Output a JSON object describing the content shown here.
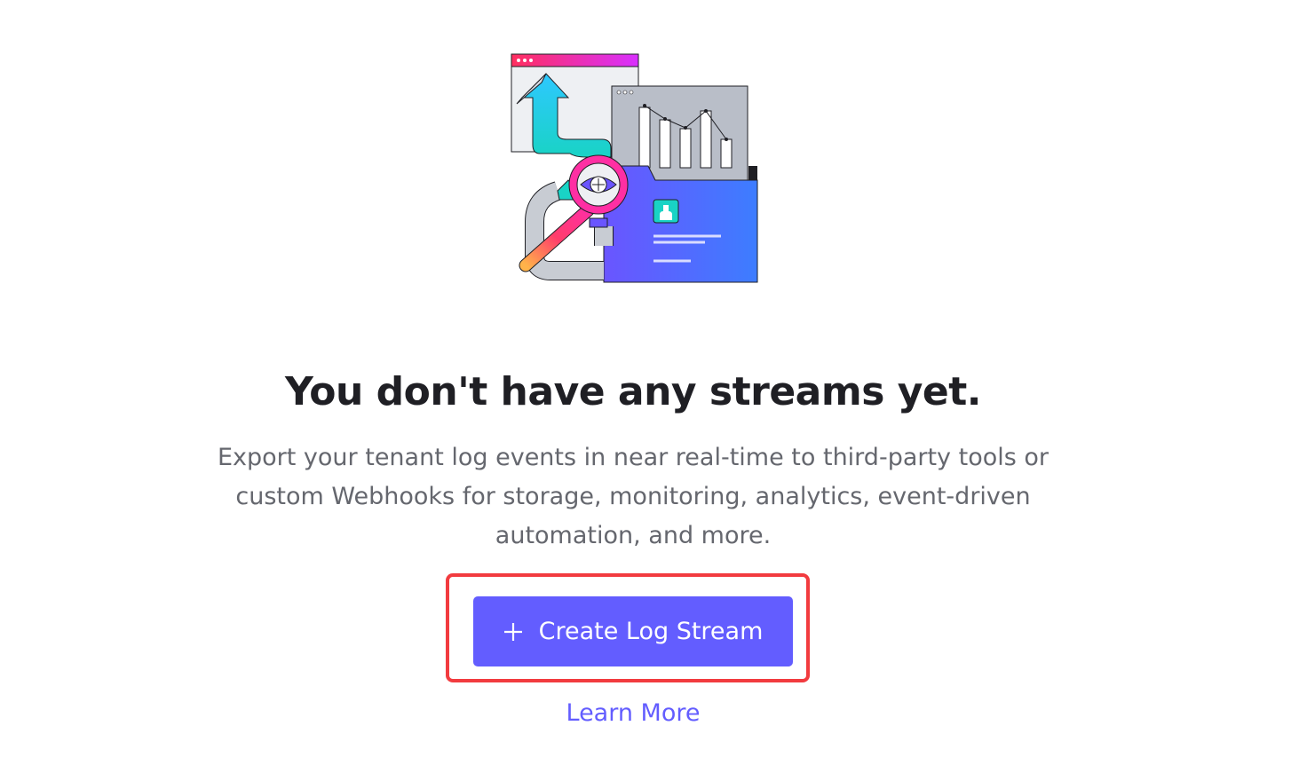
{
  "empty_state": {
    "illustration_icon": "log-stream-illustration",
    "title": "You don't have any streams yet.",
    "description": "Export your tenant log events in near real-time to third-party tools or custom Webhooks for storage, monitoring, analytics, event-driven automation, and more.",
    "create_button_label": "Create Log Stream",
    "create_button_icon": "plus-icon",
    "learn_more_label": "Learn More"
  },
  "colors": {
    "accent": "#635dff",
    "highlight_border": "#f23b3f",
    "title_text": "#1f1f24",
    "body_text": "#65676e"
  }
}
